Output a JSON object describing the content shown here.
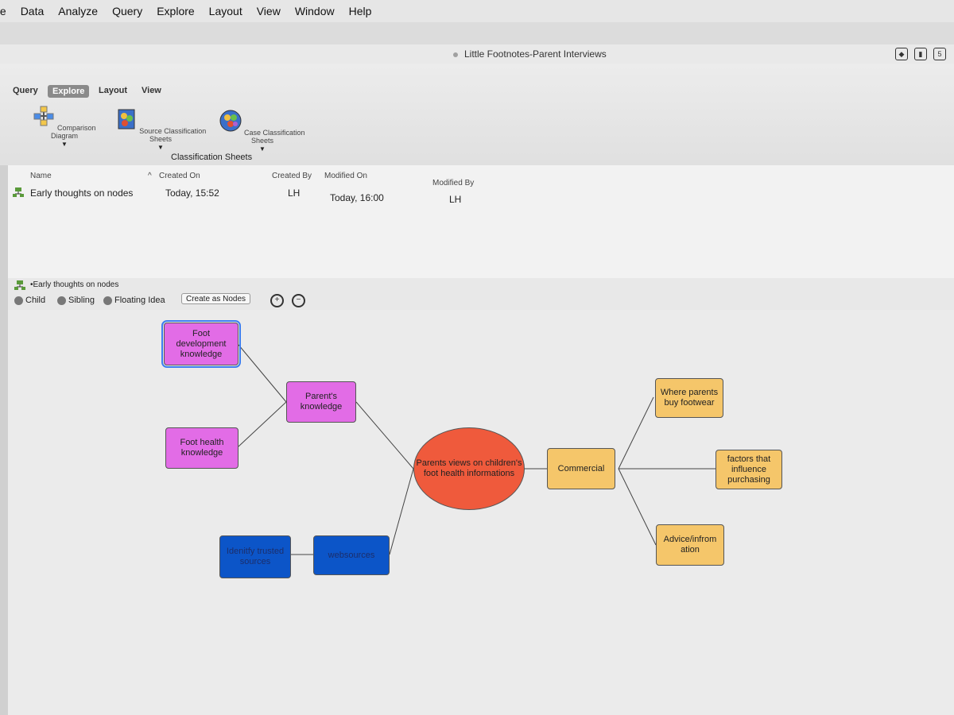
{
  "menu": [
    "te",
    "Data",
    "Analyze",
    "Query",
    "Explore",
    "Layout",
    "View",
    "Window",
    "Help"
  ],
  "window_title": "Little Footnotes-Parent Interviews",
  "ribbon": {
    "tabs": [
      "Query",
      "Explore",
      "Layout",
      "View"
    ],
    "active_tab": "Explore",
    "tools": [
      {
        "label": "Comparison Diagram"
      },
      {
        "label": "Source Classification Sheets"
      },
      {
        "label": "Case Classification Sheets"
      }
    ],
    "group_label": "Classification Sheets"
  },
  "list": {
    "columns": [
      "Name",
      "Created On",
      "Created By",
      "Modified On",
      "Modified By"
    ],
    "rows": [
      {
        "name": "Early thoughts on nodes",
        "created_on": "Today, 15:52",
        "created_by": "LH",
        "modified_on": "Today, 16:00",
        "modified_by": "LH"
      }
    ]
  },
  "map": {
    "title": "•Early thoughts on nodes",
    "toolbar": {
      "child": "Child",
      "sibling": "Sibling",
      "floating_idea": "Floating Idea",
      "create_as_nodes": "Create as Nodes"
    },
    "nodes": {
      "foot_dev": "Foot development knowledge",
      "parents_knowledge": "Parent's knowledge",
      "foot_health": "Foot health knowledge",
      "central": "Parents views on children's foot health informations",
      "commercial": "Commercial",
      "where_buy": "Where parents buy footwear",
      "factors": "factors that influence purchasing",
      "advice": "Advice/infrom ation",
      "websources": "websources",
      "trusted": "Idenitfy trusted sources"
    }
  },
  "colors": {
    "pink": "#e26ce6",
    "orange": "#f5c66a",
    "blue": "#0c55c8",
    "red": "#ef5a3c"
  }
}
